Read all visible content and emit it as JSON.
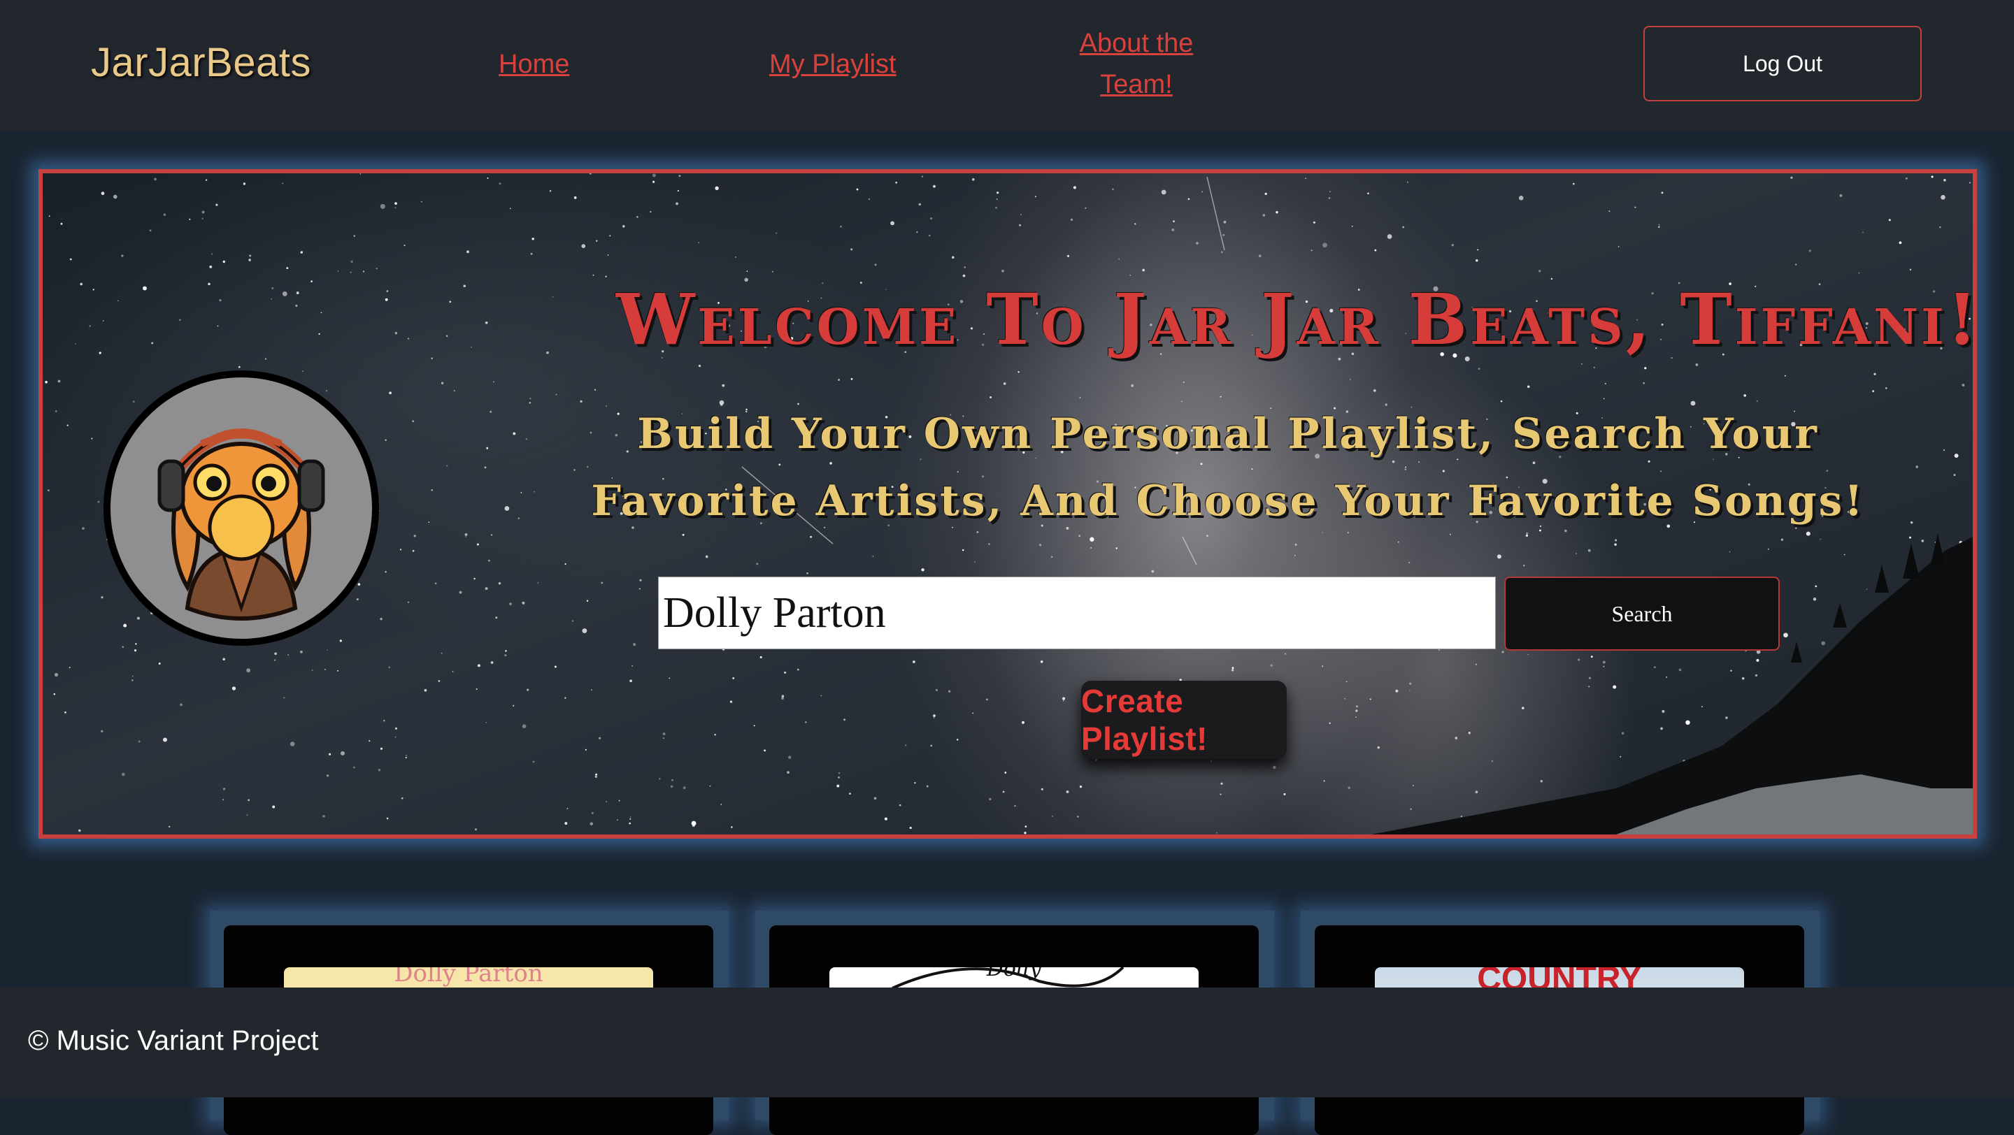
{
  "nav": {
    "brand": "JarJarBeats",
    "links": [
      "Home",
      "My Playlist",
      "About the Team!"
    ],
    "logout_label": "Log Out"
  },
  "hero": {
    "title": "Welcome To Jar Jar Beats, Tiffani!",
    "subtitle": "Build Your Own Personal Playlist, Search Your Favorite Artists, And Choose Your Favorite Songs!",
    "search_value": "Dolly Parton",
    "search_label": "Search",
    "create_label": "Create Playlist!"
  },
  "cards": [
    {
      "image_text": "Dolly Parton"
    },
    {
      "image_text": "Dolly"
    },
    {
      "image_text": "COUNTRY"
    }
  ],
  "footer": {
    "text": "© Music Variant Project"
  },
  "colors": {
    "accent": "#d63c3a",
    "gold": "#e8c873",
    "navbar": "#22262d",
    "glow": "#5096e6"
  },
  "icons": {
    "avatar": "frog-with-headphones-avatar"
  }
}
